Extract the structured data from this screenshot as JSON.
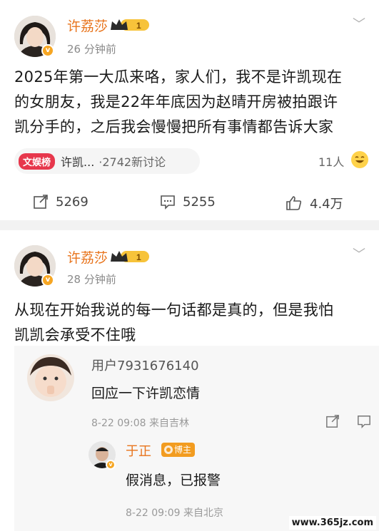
{
  "post1": {
    "author": "许荔莎",
    "level": "1",
    "time": "26 分钟前",
    "content_lines": [
      "2025年第一大瓜来咯，家人们，我不是许凯现在",
      "的女朋友，我是22年年底因为赵晴开房被拍跟许",
      "凯分手的，之后我会慢慢把所有事情都告诉大家"
    ],
    "topic_tag": "文娱榜",
    "topic_text": "许凯...",
    "topic_discuss": "·2742新讨论",
    "people_count": "11人",
    "actions": {
      "repost": "5269",
      "comment": "5255",
      "like": "4.4万"
    }
  },
  "post2": {
    "author": "许荔莎",
    "level": "1",
    "time": "28 分钟前",
    "content_lines": [
      "从现在开始我说的每一句话都是真的，但是我怕",
      "凯凯会承受不住哦"
    ],
    "comment1": {
      "user": "用户7931676140",
      "text": "回应一下许凯恋情",
      "meta": "8-22 09:08  来自吉林"
    },
    "comment2": {
      "user": "于正",
      "badge": "博主",
      "text": "假消息，已报警",
      "meta": "8-22 09:09  来自北京"
    }
  },
  "watermark": "www.365jz.com",
  "colors": {
    "name": "#e8741c",
    "topic": "#e7374c",
    "badge": "#f29c20"
  }
}
